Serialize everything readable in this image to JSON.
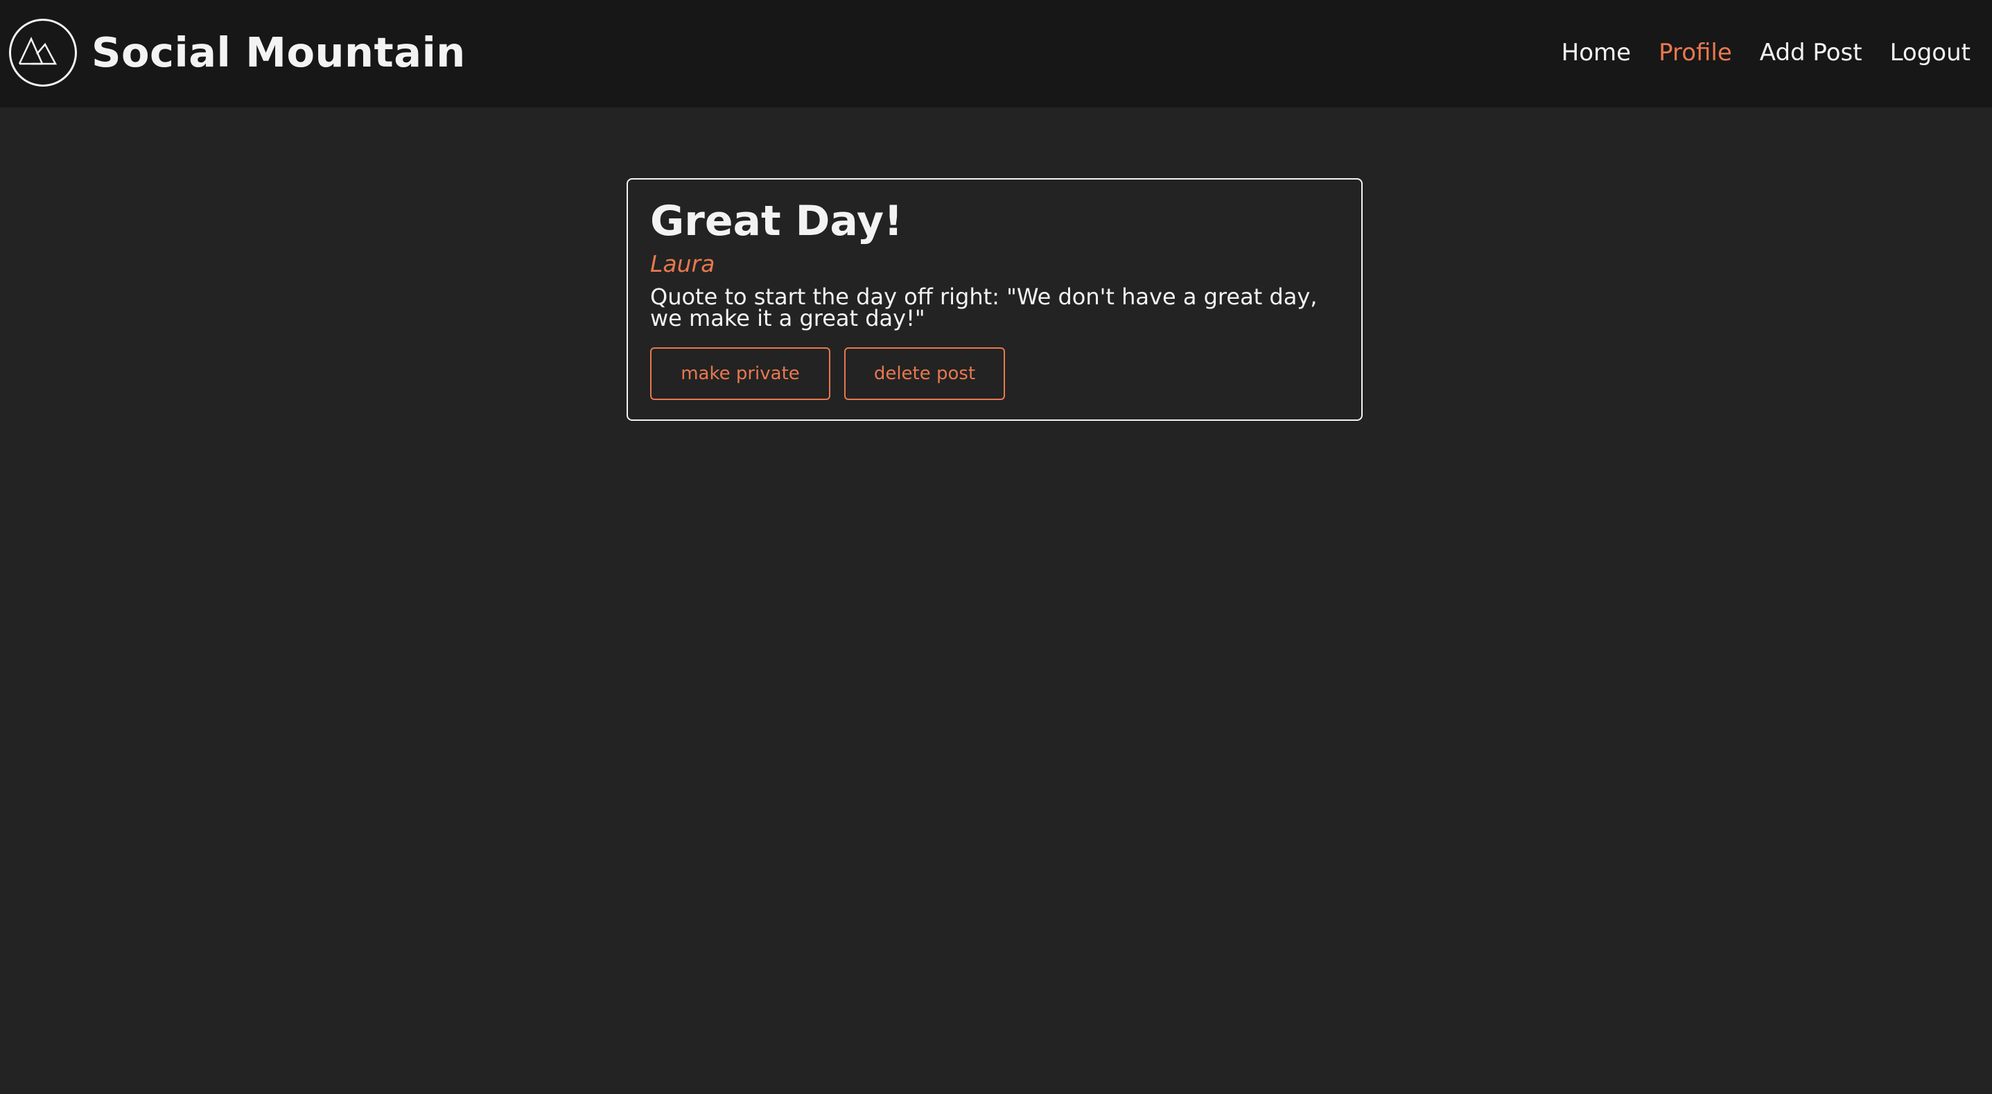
{
  "app": {
    "brand": "Social Mountain",
    "logo_icon": "mountain-logo-icon"
  },
  "nav": {
    "items": [
      {
        "label": "Home",
        "active": false
      },
      {
        "label": "Profile",
        "active": true
      },
      {
        "label": "Add Post",
        "active": false
      },
      {
        "label": "Logout",
        "active": false
      }
    ]
  },
  "post": {
    "title": "Great Day!",
    "author": "Laura",
    "body": "Quote to start the day off right: \"We don't have a great day, we make it a great day!\"",
    "make_private_label": "make private",
    "delete_label": "delete post"
  },
  "colors": {
    "accent": "#e8784f",
    "background": "#232323",
    "header_bg": "#171717",
    "text": "#f3f3f3"
  }
}
